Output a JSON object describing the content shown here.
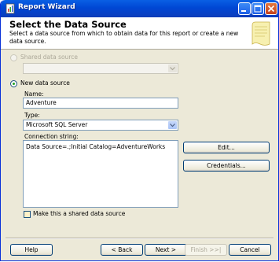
{
  "window": {
    "title": "Report Wizard"
  },
  "header": {
    "title": "Select the Data Source",
    "description": "Select a data source from which to obtain data for this report or create a new data source."
  },
  "shared_source": {
    "label": "Shared data source",
    "selected": false,
    "enabled": false,
    "value": ""
  },
  "new_source": {
    "label": "New data source",
    "selected": true,
    "name_label": "Name:",
    "name_value": "Adventure",
    "type_label": "Type:",
    "type_value": "Microsoft SQL Server",
    "conn_label": "Connection string:",
    "conn_value": "Data Source=.;Initial Catalog=AdventureWorks",
    "edit_label": "Edit...",
    "credentials_label": "Credentials...",
    "make_shared_label": "Make this a shared data source",
    "make_shared_checked": false
  },
  "footer": {
    "help": "Help",
    "back": "< Back",
    "next": "Next >",
    "finish": "Finish >>|",
    "cancel": "Cancel"
  }
}
